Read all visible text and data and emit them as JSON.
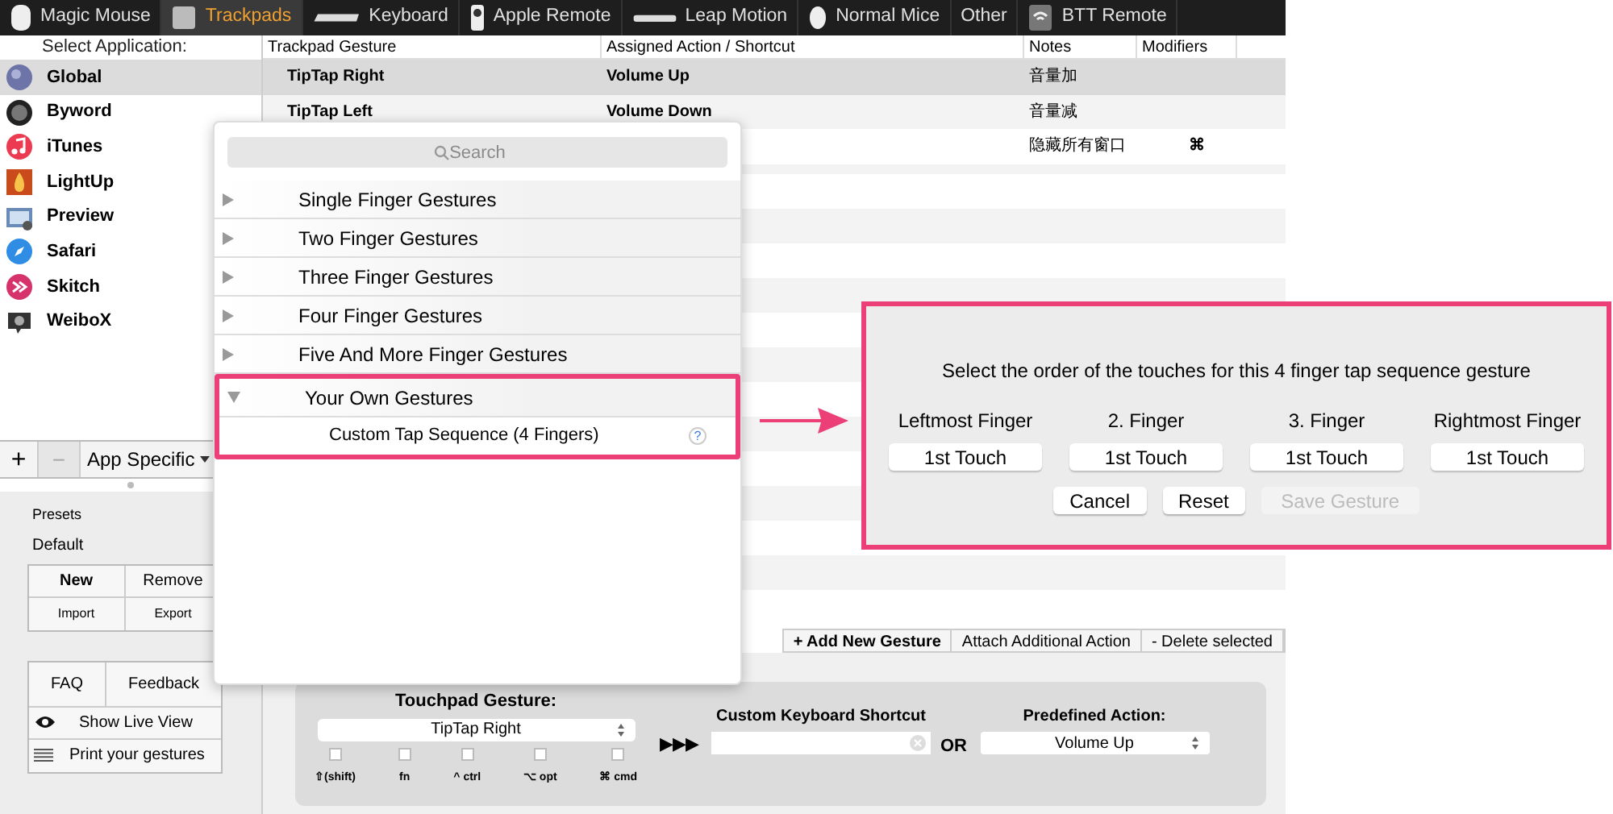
{
  "tabs": [
    {
      "label": "Magic Mouse",
      "selected": false
    },
    {
      "label": "Trackpads",
      "selected": true
    },
    {
      "label": "Keyboard",
      "selected": false
    },
    {
      "label": "Apple Remote",
      "selected": false
    },
    {
      "label": "Leap Motion",
      "selected": false
    },
    {
      "label": "Normal Mice",
      "selected": false
    },
    {
      "label": "Other",
      "selected": false
    },
    {
      "label": "BTT Remote",
      "selected": false
    }
  ],
  "sidebar": {
    "header": "Select Application:",
    "apps": [
      {
        "name": "Global",
        "selected": true
      },
      {
        "name": "Byword",
        "selected": false
      },
      {
        "name": "iTunes",
        "selected": false
      },
      {
        "name": "LightUp",
        "selected": false
      },
      {
        "name": "Preview",
        "selected": false
      },
      {
        "name": "Safari",
        "selected": false
      },
      {
        "name": "Skitch",
        "selected": false
      },
      {
        "name": "WeiboX",
        "selected": false
      }
    ],
    "add": "+",
    "remove": "−",
    "scope": "App Specific"
  },
  "presets": {
    "title": "Presets",
    "current": "Default",
    "buttons": [
      {
        "label": "New",
        "primary": true
      },
      {
        "label": "Remove",
        "primary": false
      },
      {
        "label": "Import",
        "primary": false
      },
      {
        "label": "Export",
        "primary": false
      }
    ],
    "faq": "FAQ",
    "feedback": "Feedback",
    "live_view": "Show Live View",
    "print": "Print your gestures"
  },
  "table": {
    "columns": [
      "Trackpad Gesture",
      "Assigned Action / Shortcut",
      "Notes",
      "Modifiers"
    ],
    "rows": [
      {
        "gesture": "TipTap Right",
        "action": "Volume Up",
        "notes": "音量加",
        "modifiers": "",
        "selected": true
      },
      {
        "gesture": "TipTap Left",
        "action": "Volume Down",
        "notes": "音量减",
        "modifiers": "",
        "selected": false
      },
      {
        "gesture": "",
        "action": "",
        "notes": "隐藏所有窗口",
        "modifiers": "⌘",
        "selected": false
      }
    ]
  },
  "toolbar": [
    {
      "label": "+ Add New Gesture",
      "primary": true
    },
    {
      "label": "Attach Additional Action",
      "primary": false
    },
    {
      "label": "- Delete selected",
      "primary": false
    }
  ],
  "editor": {
    "gesture_label": "Touchpad Gesture:",
    "gesture": "TipTap Right",
    "modifiers": [
      {
        "label": "⇧(shift)",
        "checked": false
      },
      {
        "label": "fn",
        "checked": false
      },
      {
        "label": "^ ctrl",
        "checked": false
      },
      {
        "label": "⌥ opt",
        "checked": false
      },
      {
        "label": "⌘ cmd",
        "checked": false
      }
    ],
    "arrows": "▶▶▶",
    "shortcut_label": "Custom Keyboard Shortcut",
    "or": "OR",
    "action_label": "Predefined Action:",
    "action": "Volume Up"
  },
  "popup": {
    "search_placeholder": "Search",
    "categories": [
      {
        "label": "Single Finger Gestures",
        "expanded": false
      },
      {
        "label": "Two Finger Gestures",
        "expanded": false
      },
      {
        "label": "Three Finger Gestures",
        "expanded": false
      },
      {
        "label": "Four Finger Gestures",
        "expanded": false
      },
      {
        "label": "Five And More Finger Gestures",
        "expanded": false
      },
      {
        "label": "Your Own Gestures",
        "expanded": true,
        "children": [
          {
            "label": "Custom Tap Sequence (4 Fingers)",
            "help": "?"
          }
        ]
      }
    ]
  },
  "dialog": {
    "message": "Select the order of the touches for this 4 finger tap sequence gesture",
    "fingers": [
      {
        "label": "Leftmost Finger",
        "value": "1st Touch"
      },
      {
        "label": "2. Finger",
        "value": "1st Touch"
      },
      {
        "label": "3. Finger",
        "value": "1st Touch"
      },
      {
        "label": "Rightmost Finger",
        "value": "1st Touch"
      }
    ],
    "buttons": [
      {
        "label": "Cancel",
        "disabled": false
      },
      {
        "label": "Reset",
        "disabled": false
      },
      {
        "label": "Save Gesture",
        "disabled": true
      }
    ]
  }
}
